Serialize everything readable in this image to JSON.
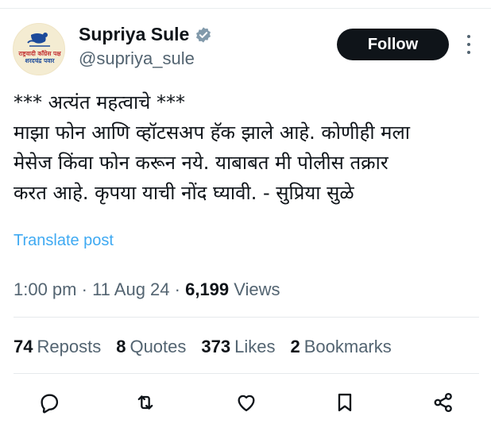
{
  "author": {
    "name": "Supriya Sule",
    "handle": "@supriya_sule",
    "avatar_text_line1": "राष्ट्रवादी काँग्रेस पक्ष",
    "avatar_text_line2": "शरदचंद्र पवार"
  },
  "follow_label": "Follow",
  "post": {
    "lines": [
      "*** अत्यंत महत्वाचे ***",
      "माझा फोन आणि व्हॉटसअप हॅक झाले आहे. कोणीही मला",
      "मेसेज किंवा फोन करून नये. याबाबत मी पोलीस तक्रार",
      "करत आहे. कृपया याची नोंद घ्यावी. - सुप्रिया सुळे"
    ],
    "translate_label": "Translate post"
  },
  "meta": {
    "time": "1:00 pm",
    "sep1": " · ",
    "date": "11 Aug 24",
    "sep2": " · ",
    "views_count": "6,199",
    "views_label": " Views"
  },
  "stats": {
    "reposts_count": "74",
    "reposts_label": "Reposts",
    "quotes_count": "8",
    "quotes_label": "Quotes",
    "likes_count": "373",
    "likes_label": "Likes",
    "bookmarks_count": "2",
    "bookmarks_label": "Bookmarks"
  },
  "actions": [
    "reply-icon",
    "repost-icon",
    "like-icon",
    "bookmark-icon",
    "share-icon"
  ],
  "colors": {
    "text": "#0f1419",
    "secondary": "#536471",
    "link": "#1d9bf0",
    "verified": "#829aab",
    "button": "#0f1419"
  }
}
